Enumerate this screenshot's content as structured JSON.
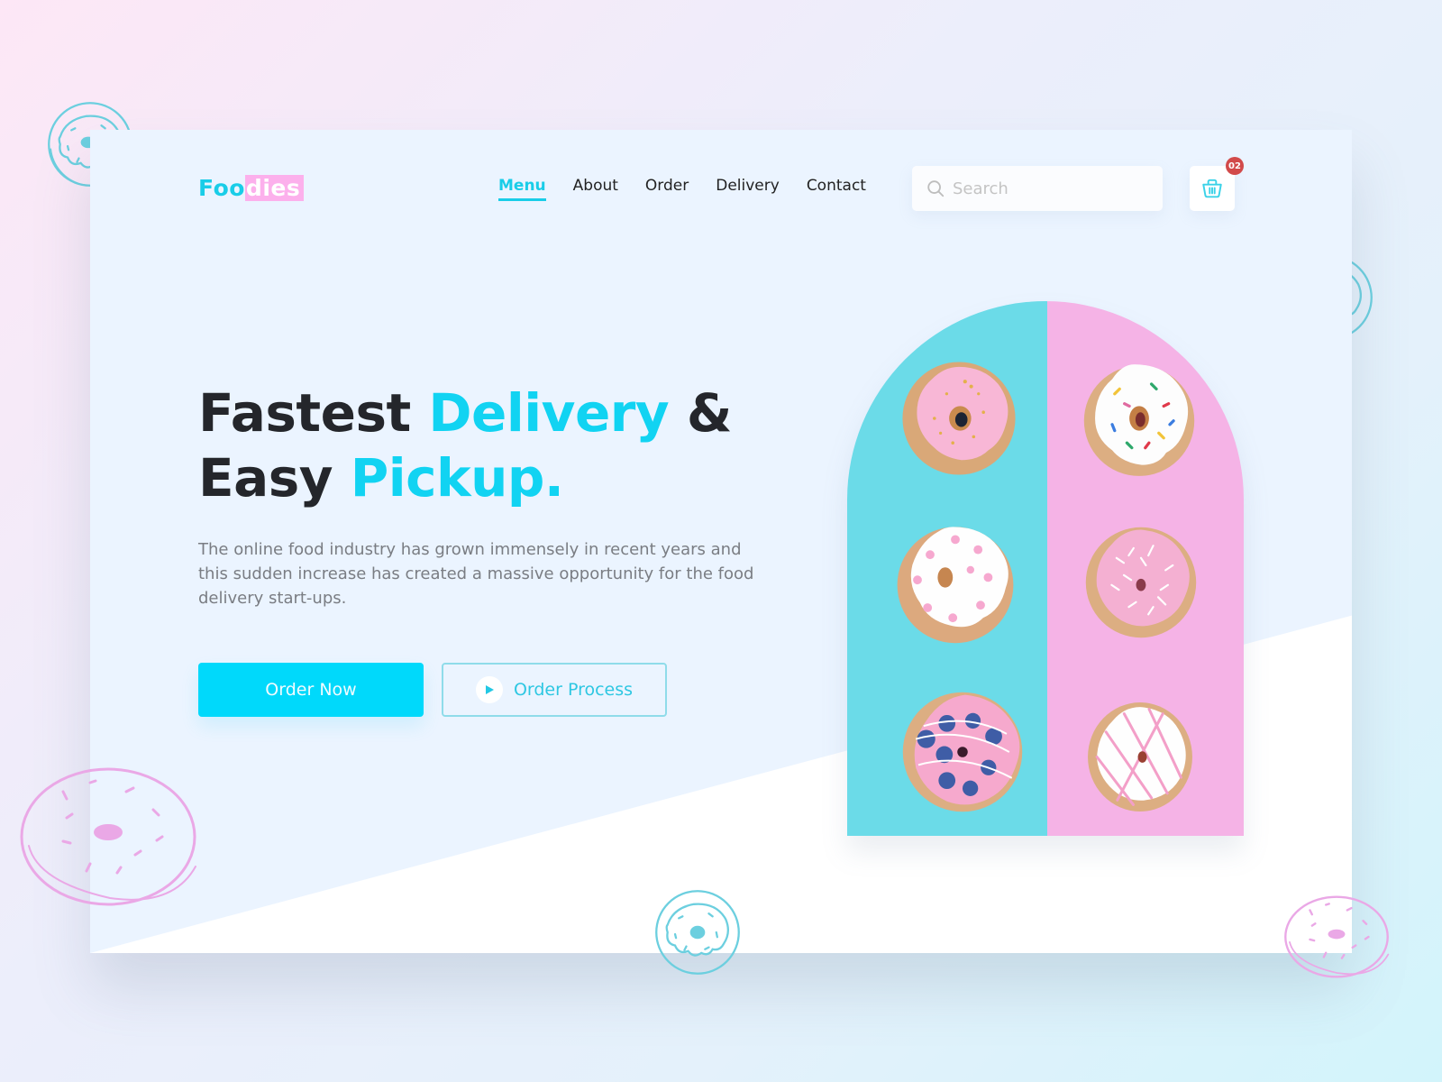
{
  "brand": {
    "logo_part1": "Foo",
    "logo_part2": "dies"
  },
  "nav": {
    "items": [
      {
        "label": "Menu",
        "active": true
      },
      {
        "label": "About",
        "active": false
      },
      {
        "label": "Order",
        "active": false
      },
      {
        "label": "Delivery",
        "active": false
      },
      {
        "label": "Contact",
        "active": false
      }
    ]
  },
  "search": {
    "placeholder": "Search",
    "value": "",
    "icon": "search-icon"
  },
  "cart": {
    "icon": "shopping-basket-icon",
    "badge_count": "02"
  },
  "hero": {
    "headline_line1_dark": "Fastest ",
    "headline_line1_accent": "Delivery",
    "headline_line1_tail": " &",
    "headline_line2_dark": "Easy ",
    "headline_line2_accent": "Pickup.",
    "description": "The online food industry has grown immensely in recent years and this sudden increase has created a massive opportunity for the food delivery start-ups.",
    "primary_button": "Order Now",
    "secondary_button": "Order Process",
    "secondary_icon": "play-icon"
  },
  "image": {
    "alt": "Six glazed donuts on blue and pink background",
    "donuts": [
      {
        "glaze": "#f7b6d6",
        "topping": "gold-sprinkles"
      },
      {
        "glaze": "#ffffff",
        "topping": "rainbow-sprinkles"
      },
      {
        "glaze": "#ffffff",
        "topping": "pink-dots"
      },
      {
        "glaze": "#f6b7d4",
        "topping": "coconut"
      },
      {
        "glaze": "#f7a9cf",
        "topping": "blueberries"
      },
      {
        "glaze": "#ffffff",
        "topping": "pink-drizzle"
      }
    ]
  },
  "colors": {
    "accent": "#11d3f2",
    "logo_highlight": "#fcb0ec",
    "badge": "#d24a4a",
    "text_dark": "#24262b",
    "text_muted": "#7a7d83",
    "panel_blue": "#6bdbe8",
    "panel_pink": "#f5b3e6"
  }
}
